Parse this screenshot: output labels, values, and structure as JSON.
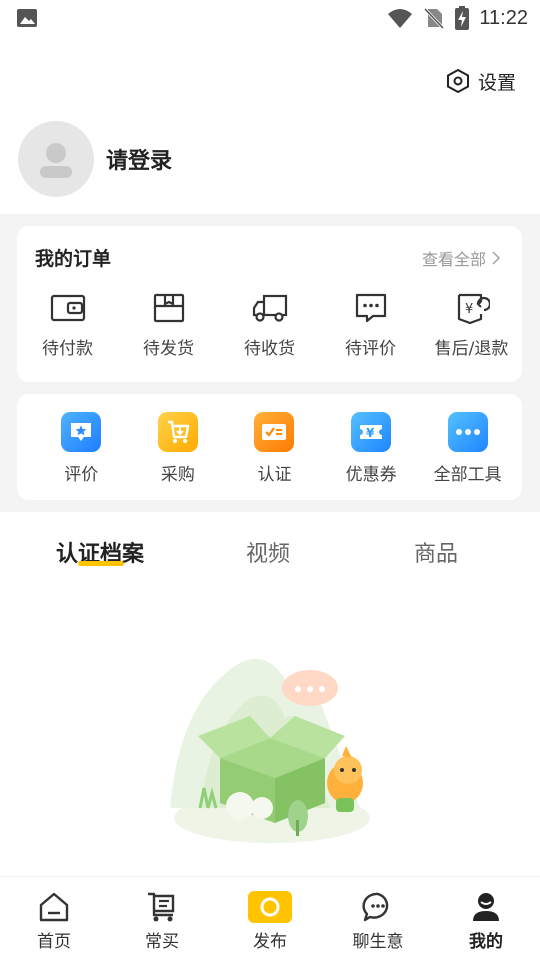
{
  "status_bar": {
    "time": "11:22"
  },
  "header": {
    "settings_label": "设置"
  },
  "profile": {
    "login_text": "请登录"
  },
  "orders": {
    "title": "我的订单",
    "view_all": "查看全部",
    "items": [
      {
        "label": "待付款",
        "icon": "wallet-icon"
      },
      {
        "label": "待发货",
        "icon": "package-icon"
      },
      {
        "label": "待收货",
        "icon": "truck-icon"
      },
      {
        "label": "待评价",
        "icon": "comment-icon"
      },
      {
        "label": "售后/退款",
        "icon": "refund-icon"
      }
    ]
  },
  "tools": {
    "items": [
      {
        "label": "评价",
        "icon": "review-star-icon",
        "color": "#2d8cff"
      },
      {
        "label": "采购",
        "icon": "purchase-cart-icon",
        "color": "#ffb300"
      },
      {
        "label": "认证",
        "icon": "certification-icon",
        "color": "#ff8a00"
      },
      {
        "label": "优惠券",
        "icon": "coupon-icon",
        "color": "#2d9bff"
      },
      {
        "label": "全部工具",
        "icon": "more-dots-icon",
        "color": "#2d9bff"
      }
    ]
  },
  "tabs": [
    {
      "label": "认证档案",
      "active": true
    },
    {
      "label": "视频",
      "active": false
    },
    {
      "label": "商品",
      "active": false
    }
  ],
  "bottom_nav": [
    {
      "label": "首页",
      "icon": "home-icon",
      "active": false
    },
    {
      "label": "常买",
      "icon": "cart-list-icon",
      "active": false
    },
    {
      "label": "发布",
      "icon": "publish-icon",
      "active": false
    },
    {
      "label": "聊生意",
      "icon": "chat-icon",
      "active": false
    },
    {
      "label": "我的",
      "icon": "profile-icon",
      "active": true
    }
  ],
  "colors": {
    "accent": "#ffc300",
    "background_grey": "#f4f4f4"
  }
}
